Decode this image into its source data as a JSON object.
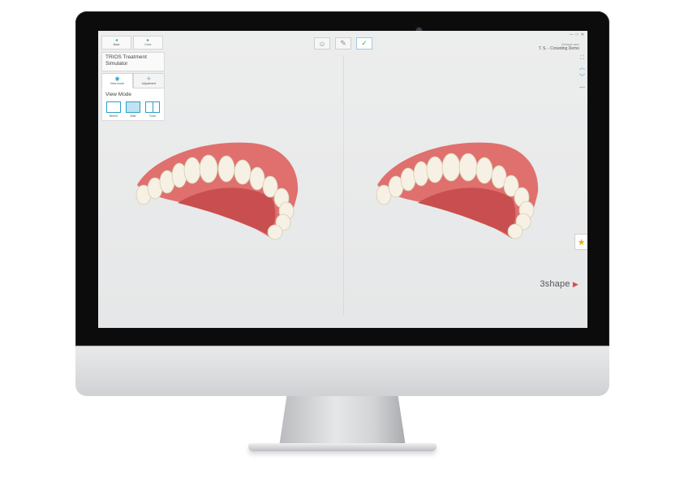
{
  "window": {
    "controls": [
      "—",
      "□",
      "✕"
    ],
    "user_label": "Default user",
    "case_title": "T. S. - Crowding Demo"
  },
  "panel": {
    "nav": [
      {
        "label": "Back",
        "icon": "arrow-left-icon",
        "glyph": "◂"
      },
      {
        "label": "Cont.",
        "icon": "arrow-right-icon",
        "glyph": "▸"
      }
    ],
    "title": "TRIOS Treatment Simulator",
    "tabs": [
      {
        "label": "View mode",
        "icon": "eye-icon",
        "glyph": "◉",
        "active": true
      },
      {
        "label": "Adjustment",
        "icon": "adjust-icon",
        "glyph": "⟡",
        "active": false
      }
    ],
    "view_mode": {
      "title": "View Mode",
      "options": [
        {
          "label": "Before",
          "active": false
        },
        {
          "label": "After",
          "active": true
        },
        {
          "label": "Dual",
          "active": false
        }
      ]
    }
  },
  "thumbnails": [
    {
      "icon": "patient-face-icon",
      "glyph": "☺",
      "active": false
    },
    {
      "icon": "scan-icon",
      "glyph": "✎",
      "active": false
    },
    {
      "icon": "tooth-check-icon",
      "glyph": "✓",
      "active": true
    }
  ],
  "side_tools": [
    {
      "icon": "fit-view-icon",
      "glyph": "⛶"
    },
    {
      "icon": "chevron-up-icon",
      "glyph": "︿"
    },
    {
      "icon": "chevron-down-icon",
      "glyph": "﹀"
    },
    {
      "icon": "minus-icon",
      "glyph": "—"
    }
  ],
  "favorite": {
    "icon": "star-icon",
    "glyph": "★"
  },
  "brand": {
    "text": "3shape",
    "mark": "▶"
  },
  "colors": {
    "accent": "#2aa0c8",
    "gum": "#e0706d",
    "tooth": "#f6f1e4"
  }
}
